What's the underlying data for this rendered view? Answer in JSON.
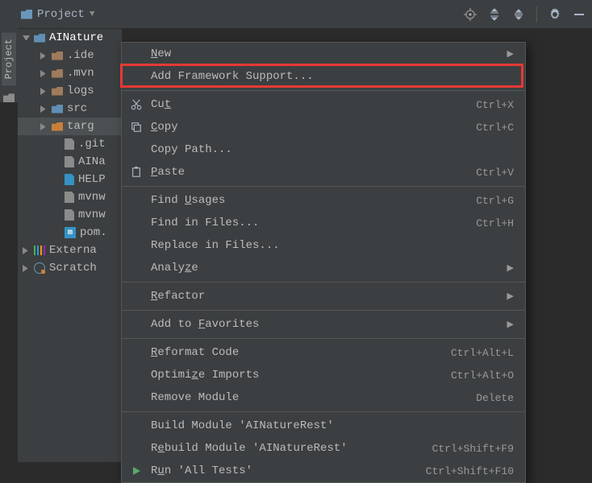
{
  "toolbar": {
    "project_label": "Project"
  },
  "sidebar": {
    "label": "Project"
  },
  "tree": {
    "root": "AINature",
    "items": [
      {
        "label": ".ide",
        "kind": "fld"
      },
      {
        "label": ".mvn",
        "kind": "fld"
      },
      {
        "label": "logs",
        "kind": "fld"
      },
      {
        "label": "src",
        "kind": "fld blue"
      },
      {
        "label": "targ",
        "kind": "fld orange",
        "sel": true
      },
      {
        "label": ".git",
        "kind": "file",
        "leaf": true
      },
      {
        "label": "AINa",
        "kind": "file",
        "leaf": true
      },
      {
        "label": "HELP",
        "kind": "file md",
        "leaf": true
      },
      {
        "label": "mvnw",
        "kind": "file",
        "leaf": true
      },
      {
        "label": "mvnw",
        "kind": "file",
        "leaf": true
      },
      {
        "label": "pom.",
        "kind": "file m",
        "leaf": true,
        "glyph": "m"
      }
    ],
    "external": "Externa",
    "scratches": "Scratch"
  },
  "context_menu": {
    "items": [
      {
        "icon": "",
        "label": "New",
        "u": "N",
        "shortcut": "",
        "sub": true
      },
      {
        "icon": "",
        "label": "Add Framework Support...",
        "shortcut": "",
        "highlighted": true
      },
      {
        "sep": true
      },
      {
        "icon": "cut",
        "label": "Cut",
        "u": "t",
        "pre": "Cu",
        "shortcut": "Ctrl+X"
      },
      {
        "icon": "copy",
        "label": "Copy",
        "u": "C",
        "post": "opy",
        "shortcut": "Ctrl+C"
      },
      {
        "icon": "",
        "label": "Copy Path...",
        "shortcut": ""
      },
      {
        "icon": "paste",
        "label": "Paste",
        "u": "P",
        "post": "aste",
        "shortcut": "Ctrl+V"
      },
      {
        "sep": true
      },
      {
        "icon": "",
        "label": "Find Usages",
        "u": "U",
        "pre": "Find ",
        "post": "sages",
        "shortcut": "Ctrl+G"
      },
      {
        "icon": "",
        "label": "Find in Files...",
        "shortcut": "Ctrl+H"
      },
      {
        "icon": "",
        "label": "Replace in Files...",
        "shortcut": ""
      },
      {
        "icon": "",
        "label": "Analyze",
        "u": "z",
        "pre": "Analy",
        "post": "e",
        "shortcut": "",
        "sub": true
      },
      {
        "sep": true
      },
      {
        "icon": "",
        "label": "Refactor",
        "u": "R",
        "post": "efactor",
        "shortcut": "",
        "sub": true
      },
      {
        "sep": true
      },
      {
        "icon": "",
        "label": "Add to Favorites",
        "u": "F",
        "pre": "Add to ",
        "post": "avorites",
        "shortcut": "",
        "sub": true
      },
      {
        "sep": true
      },
      {
        "icon": "",
        "label": "Reformat Code",
        "u": "R",
        "post": "eformat Code",
        "shortcut": "Ctrl+Alt+L"
      },
      {
        "icon": "",
        "label": "Optimize Imports",
        "u": "z",
        "pre": "Optimi",
        "post": "e Imports",
        "shortcut": "Ctrl+Alt+O"
      },
      {
        "icon": "",
        "label": "Remove Module",
        "shortcut": "Delete"
      },
      {
        "sep": true
      },
      {
        "icon": "",
        "label": "Build Module 'AINatureRest'",
        "shortcut": ""
      },
      {
        "icon": "",
        "label": "Rebuild Module 'AINatureRest'",
        "u": "e",
        "pre": "R",
        "post": "build Module 'AINatureRest'",
        "shortcut": "Ctrl+Shift+F9"
      },
      {
        "icon": "run",
        "label": "Run 'All Tests'",
        "u": "u",
        "pre": "R",
        "post": "n 'All Tests'",
        "shortcut": "Ctrl+Shift+F10"
      }
    ]
  }
}
